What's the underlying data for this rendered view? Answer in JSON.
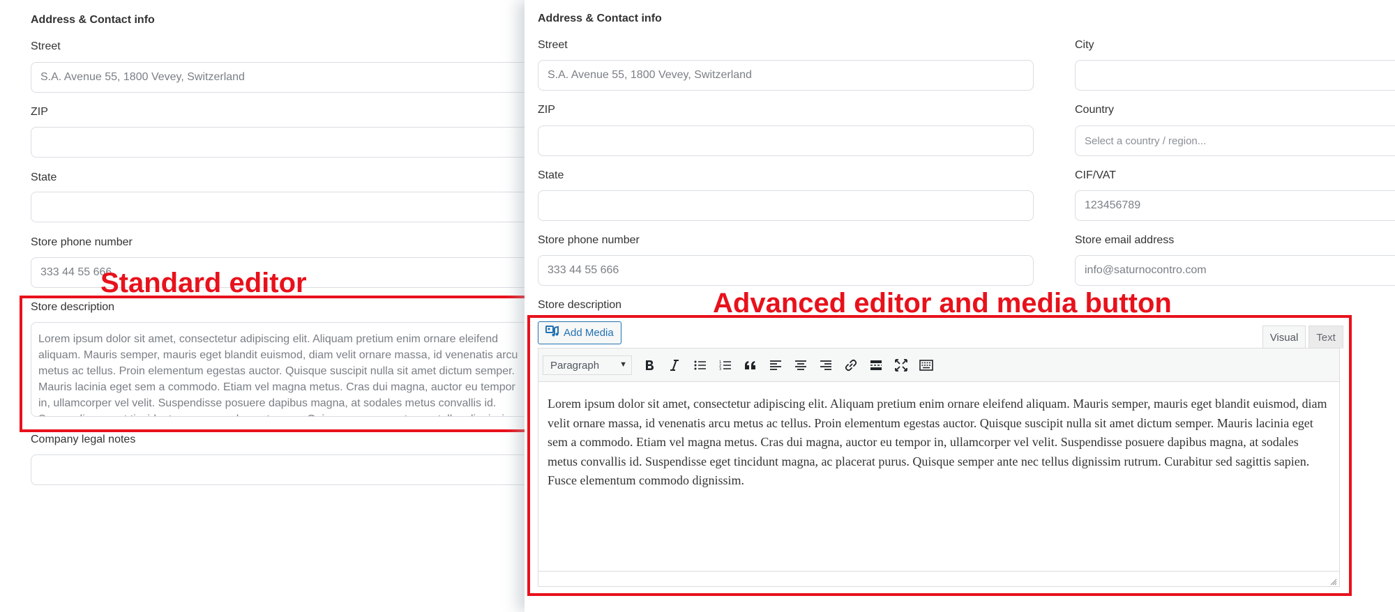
{
  "left_panel": {
    "section_title": "Address & Contact info",
    "fields": {
      "street": {
        "label": "Street",
        "value": "S.A. Avenue 55, 1800 Vevey, Switzerland"
      },
      "zip": {
        "label": "ZIP",
        "value": ""
      },
      "state": {
        "label": "State",
        "value": ""
      },
      "phone": {
        "label": "Store phone number",
        "value": "333 44 55 666"
      },
      "description": {
        "label": "Store description",
        "value": "Lorem ipsum dolor sit amet, consectetur adipiscing elit. Aliquam pretium enim ornare eleifend aliquam. Mauris semper, mauris eget blandit euismod, diam velit ornare massa, id venenatis arcu metus ac tellus. Proin elementum egestas auctor. Quisque suscipit nulla sit amet dictum semper. Mauris lacinia eget sem a commodo. Etiam vel magna metus. Cras dui magna, auctor eu tempor in, ullamcorper vel velit. Suspendisse posuere dapibus magna, at sodales metus convallis id. Suspendisse eget tincidunt magna, ac placerat purus. Quisque semper ante nec tellus dignissim rutrum. Curabitur sed sagittis sapien. Fusce elementum commodo dignissim."
      },
      "legal_notes": {
        "label": "Company legal notes",
        "value": ""
      }
    }
  },
  "right_panel": {
    "section_title": "Address & Contact info",
    "fields": {
      "street": {
        "label": "Street",
        "value": "S.A. Avenue 55, 1800 Vevey, Switzerland"
      },
      "city": {
        "label": "City",
        "value": ""
      },
      "zip": {
        "label": "ZIP",
        "value": ""
      },
      "country": {
        "label": "Country",
        "placeholder": "Select a country / region..."
      },
      "state": {
        "label": "State",
        "value": ""
      },
      "vat": {
        "label": "CIF/VAT",
        "value": "123456789"
      },
      "phone": {
        "label": "Store phone number",
        "value": "333 44 55 666"
      },
      "email": {
        "label": "Store email address",
        "value": "info@saturnocontro.com"
      },
      "description_label": "Store description"
    },
    "editor": {
      "add_media_label": "Add Media",
      "tab_visual": "Visual",
      "tab_text": "Text",
      "format_value": "Paragraph",
      "toolbar_icons": [
        "bold-icon",
        "italic-icon",
        "bullet-list-icon",
        "numbered-list-icon",
        "blockquote-icon",
        "align-left-icon",
        "align-center-icon",
        "align-right-icon",
        "link-icon",
        "read-more-icon",
        "fullscreen-icon",
        "toolbar-toggle-icon"
      ],
      "content": "Lorem ipsum dolor sit amet, consectetur adipiscing elit. Aliquam pretium enim ornare eleifend aliquam. Mauris semper, mauris eget blandit euismod, diam velit ornare massa, id venenatis arcu metus ac tellus. Proin elementum egestas auctor. Quisque suscipit nulla sit amet dictum semper. Mauris lacinia eget sem a commodo. Etiam vel magna metus. Cras dui magna, auctor eu tempor in, ullamcorper vel velit. Suspendisse posuere dapibus magna, at sodales metus convallis id. Suspendisse eget tincidunt magna, ac placerat purus. Quisque semper ante nec tellus dignissim rutrum. Curabitur sed sagittis sapien. Fusce elementum commodo dignissim."
    }
  },
  "annotations": {
    "standard_editor": "Standard editor",
    "advanced_editor": "Advanced editor and media button",
    "highlight_color": "#e8111b"
  }
}
